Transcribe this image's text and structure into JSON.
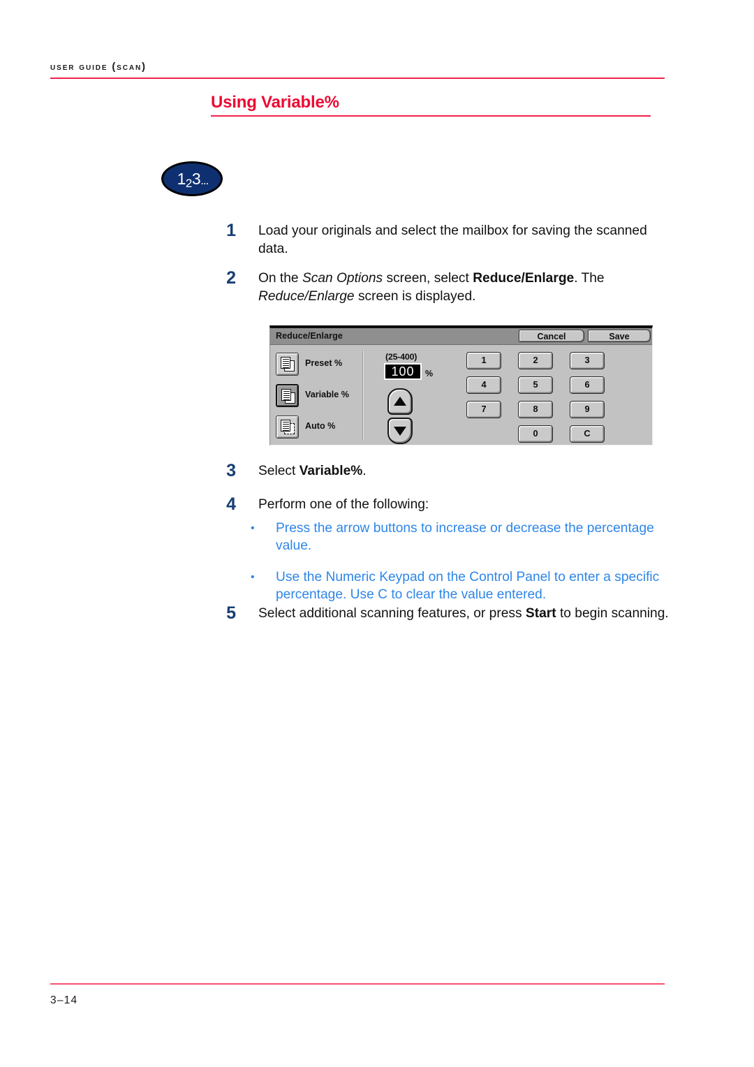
{
  "page": {
    "running_header": "USER GUIDE (SCAN)",
    "heading": "Using Variable%",
    "footer_page_number": "3–14",
    "accent_red": "#ED0A33",
    "rule_red": "#F2224A",
    "step_number_blue": "#163E73",
    "bullet_blue": "#2E86E8",
    "badge_navy": "#0F3070"
  },
  "badge": {
    "digit1": "1",
    "digit2": "2",
    "digit3": "3",
    "dots": "..."
  },
  "steps": [
    {
      "number": "1",
      "text_parts": [
        {
          "text": "Load your originals and select the mailbox for saving the scanned data.",
          "style": "normal"
        }
      ]
    },
    {
      "number": "2",
      "text_parts": [
        {
          "text": "On the ",
          "style": "normal"
        },
        {
          "text": "Scan Options",
          "style": "italic"
        },
        {
          "text": " screen, select ",
          "style": "normal"
        },
        {
          "text": "Reduce/Enlarge",
          "style": "bold"
        },
        {
          "text": ". The ",
          "style": "normal"
        },
        {
          "text": "Reduce/Enlarge",
          "style": "italic"
        },
        {
          "text": " screen is displayed.",
          "style": "normal"
        }
      ]
    },
    {
      "number": "3",
      "text_parts": [
        {
          "text": "Select ",
          "style": "normal"
        },
        {
          "text": "Variable%",
          "style": "bold"
        },
        {
          "text": ".",
          "style": "normal"
        }
      ]
    },
    {
      "number": "4",
      "text_parts": [
        {
          "text": "Perform one of the following:",
          "style": "normal"
        }
      ]
    },
    {
      "number": "5",
      "text_parts": [
        {
          "text": "Select additional scanning features, or press ",
          "style": "normal"
        },
        {
          "text": "Start",
          "style": "bold"
        },
        {
          "text": " to begin scanning.",
          "style": "normal"
        }
      ]
    }
  ],
  "step_text": {
    "s1": "Load your originals and select the mailbox for saving the scanned data.",
    "s2_a": "On the ",
    "s2_b": "Scan Options",
    "s2_c": " screen, select ",
    "s2_d": "Reduce/Enlarge",
    "s2_e": ". The ",
    "s2_f": "Reduce/Enlarge",
    "s2_g": " screen is displayed.",
    "s3_a": "Select ",
    "s3_b": "Variable%",
    "s3_c": ".",
    "s4_a": "Perform one of the following:",
    "s5_a": "Select additional scanning features, or press ",
    "s5_b": "Start",
    "s5_c": " to begin scanning."
  },
  "bullets": [
    {
      "marker": "•",
      "text": "Press the arrow buttons to increase or decrease the percentage value."
    },
    {
      "marker": "•",
      "text": "Use the Numeric Keypad on the Control Panel to enter a specific percentage. Use C to clear the value entered."
    }
  ],
  "ui_panel": {
    "titlebar": {
      "title": "Reduce/Enlarge",
      "cancel_label": "Cancel",
      "save_label": "Save"
    },
    "options": [
      {
        "label": "Preset %",
        "icon": "document-preset-icon",
        "selected": false
      },
      {
        "label": "Variable %",
        "icon": "document-variable-icon",
        "selected": true
      },
      {
        "label": "Auto %",
        "icon": "document-auto-icon",
        "selected": false
      }
    ],
    "stepper": {
      "range_label": "(25-400)",
      "value": "100",
      "unit": "%",
      "up_icon": "triangle-up-icon",
      "down_icon": "triangle-down-icon"
    },
    "keypad": [
      "1",
      "2",
      "3",
      "4",
      "5",
      "6",
      "7",
      "8",
      "9",
      "0",
      "C"
    ]
  }
}
